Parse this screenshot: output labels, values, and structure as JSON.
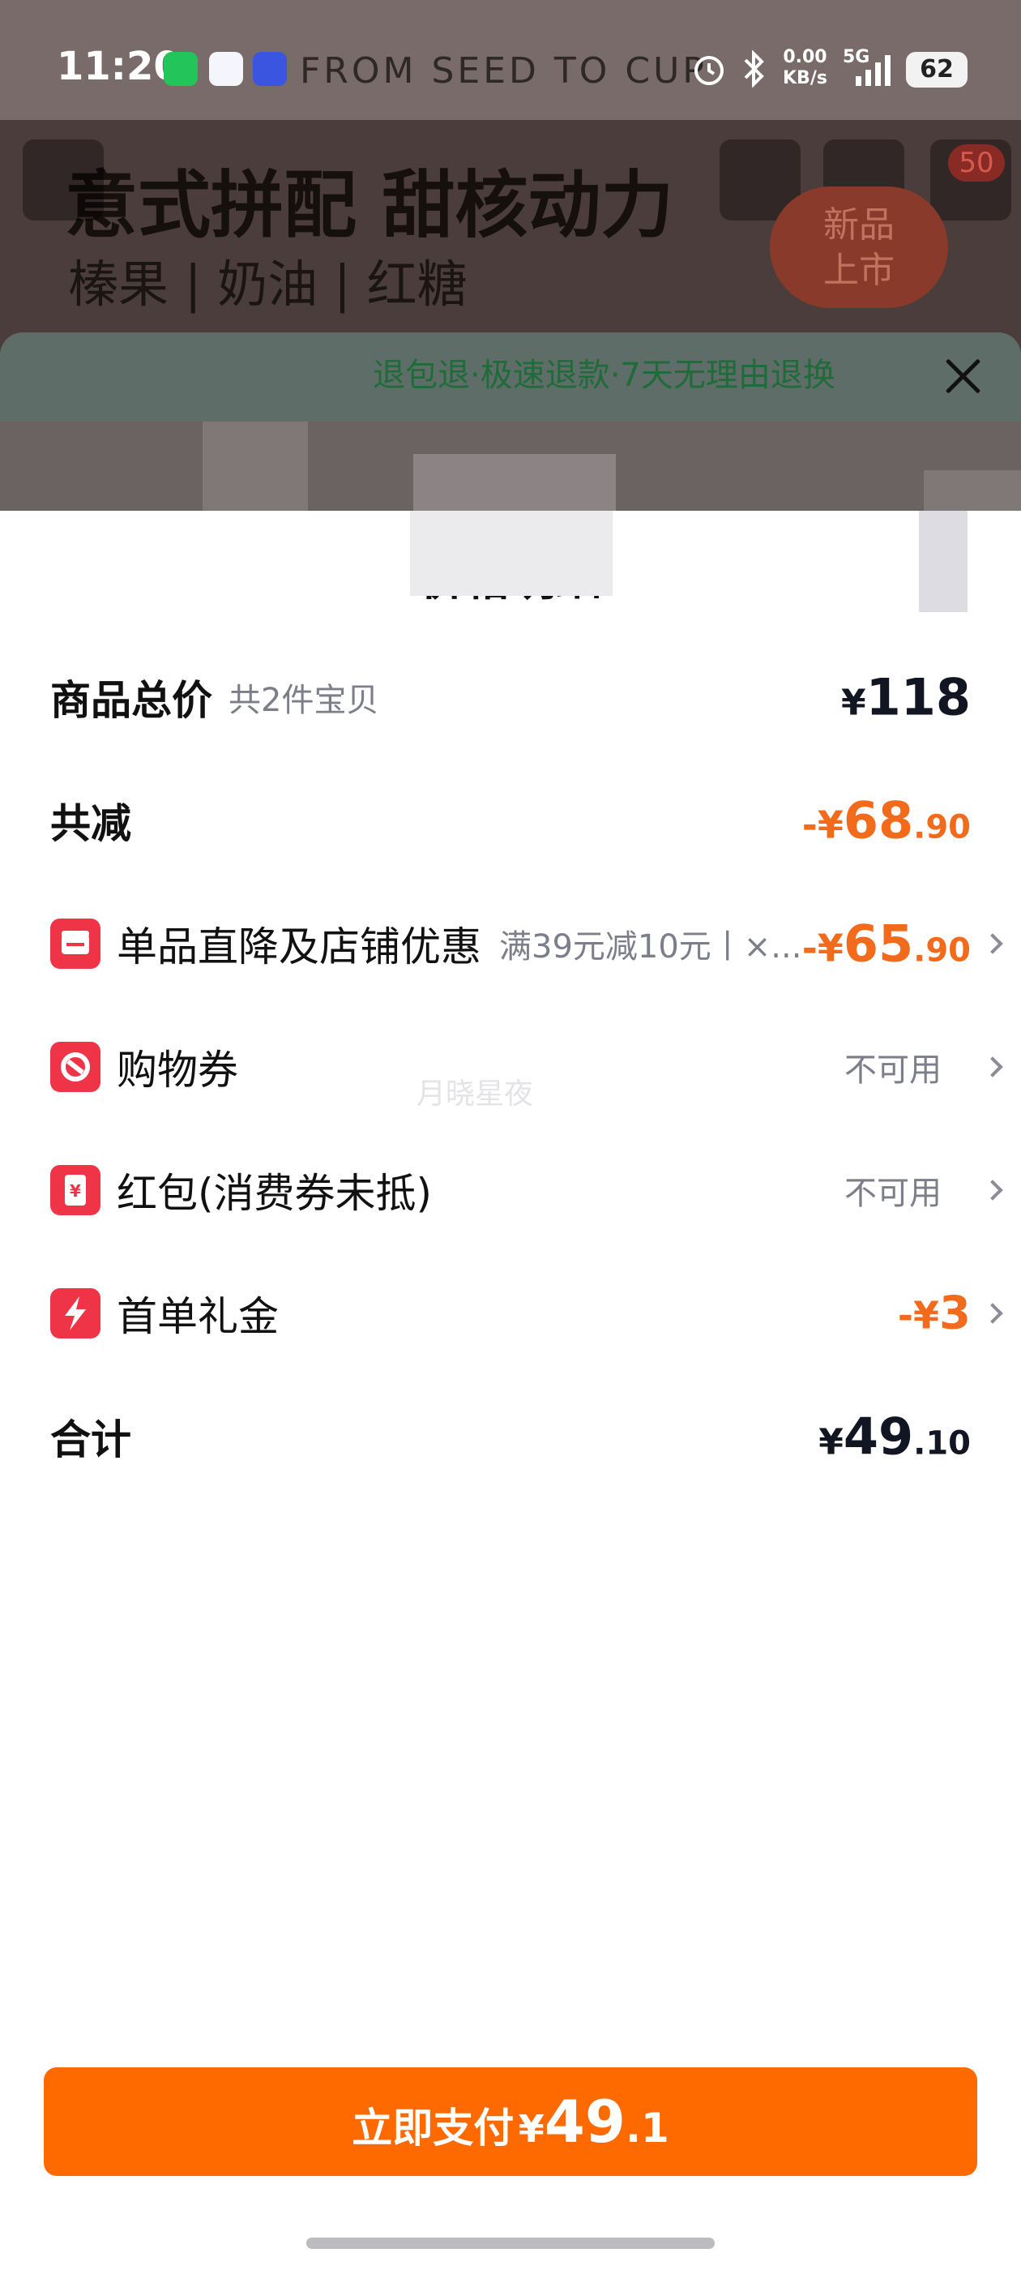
{
  "status_bar": {
    "time": "11:20",
    "net_speed_value": "0.00",
    "net_speed_unit": "KB/s",
    "network": "5G",
    "battery": "62",
    "icons": [
      "wechat-icon",
      "chat-app-icon",
      "vivo-icon",
      "alarm-icon",
      "bluetooth-icon",
      "signal-icon"
    ]
  },
  "background_page": {
    "header_text": "FROM SEED TO CUP",
    "title": "意式拼配 甜核动力",
    "subtitle": "榛果 | 奶油 | 红糖",
    "notice": "退包退·极速退款·7天无理由退换",
    "bubble": "新品\n上市",
    "badge": "50"
  },
  "sheet": {
    "title": "价格明细",
    "watermark": "月晓星夜",
    "rows": {
      "total": {
        "label": "商品总价",
        "note": "共2件宝贝",
        "currency": "¥",
        "amount": "118"
      },
      "reduction": {
        "label": "共减",
        "prefix": "-¥",
        "integer": "68",
        "decimal": ".90"
      },
      "store_discount": {
        "label": "单品直降及店铺优惠",
        "note": "满39元减10元丨×...",
        "prefix": "-¥",
        "integer": "65",
        "decimal": ".90"
      },
      "coupon": {
        "label": "购物券",
        "value": "不可用"
      },
      "red_packet": {
        "label": "红包(消费券未抵)",
        "value": "不可用"
      },
      "first_order": {
        "label": "首单礼金",
        "prefix": "-¥",
        "integer": "3"
      },
      "sum": {
        "label": "合计",
        "currency": "¥",
        "integer": "49",
        "decimal": ".10"
      }
    }
  },
  "pay_button": {
    "label": "立即支付",
    "currency": "¥",
    "integer": "49",
    "decimal": ".1"
  },
  "colors": {
    "accent": "#ff6a00",
    "discount": "#f26a1b",
    "icon_red": "#f03448"
  }
}
